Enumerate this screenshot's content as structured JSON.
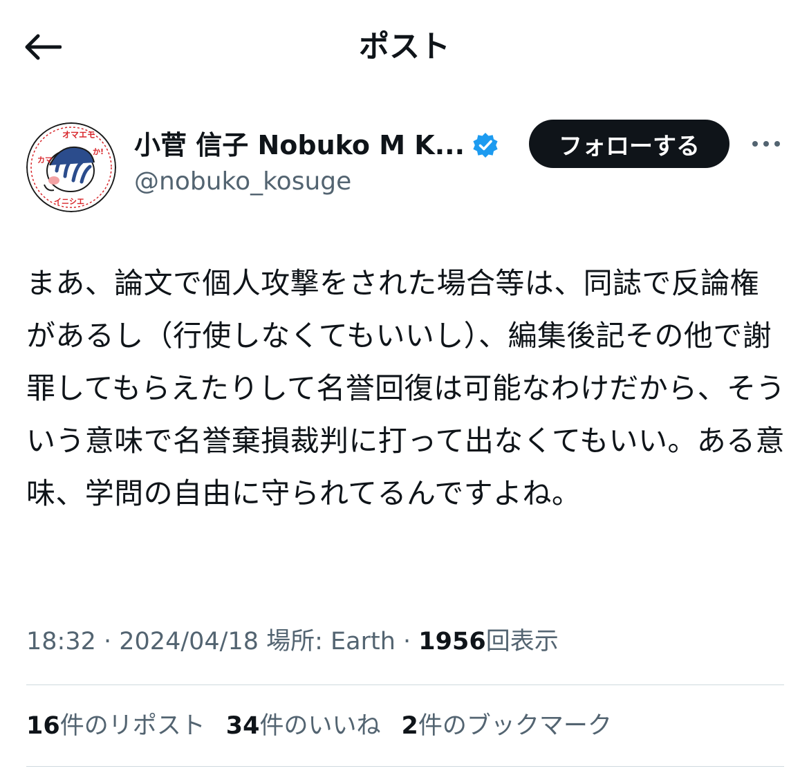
{
  "header": {
    "title": "ポスト",
    "back_icon": "arrow-left-icon"
  },
  "author": {
    "display_name": "小菅 信子 Nobuko M K...",
    "handle": "@nobuko_kosuge",
    "verified_icon": "verified-badge-icon",
    "follow_label": "フォローする",
    "more_icon": "more-horizontal-icon",
    "avatar_text": "オマエモか！イニシエナント カマBYアカミン",
    "colors": {
      "verified": "#1d9bf0",
      "follow_bg": "#0f1419",
      "avatar_red": "#d8262b",
      "avatar_blue": "#2b4c8c"
    }
  },
  "tweet": {
    "text": "まあ、論文で個人攻撃をされた場合等は、同誌で反論権があるし（行使しなくてもいいし）、編集後記その他で謝罪してもらえたりして名誉回復は可能なわけだから、そういう意味で名誉棄損裁判に打って出なくてもいい。ある意味、学問の自由に守られてるんですよね。"
  },
  "meta": {
    "time": "18:32",
    "sep1": " · ",
    "date": "2024/04/18",
    "location": " 場所: Earth",
    "sep2": " · ",
    "views_count": "1956",
    "views_label": "回表示"
  },
  "stats": {
    "reposts_count": "16",
    "reposts_label": "件のリポスト",
    "likes_count": "34",
    "likes_label": "件のいいね",
    "bookmarks_count": "2",
    "bookmarks_label": "件のブックマーク"
  }
}
